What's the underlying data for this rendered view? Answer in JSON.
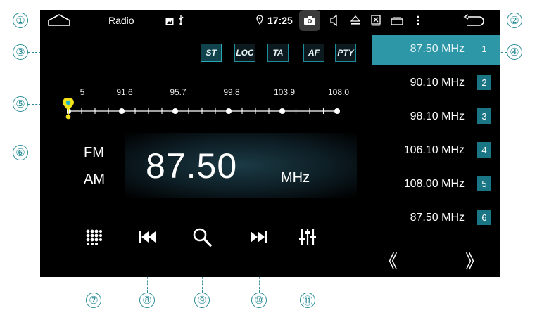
{
  "status_bar": {
    "app_title": "Radio",
    "time": "17:25"
  },
  "toggles": [
    {
      "label": "ST",
      "active": true
    },
    {
      "label": "LOC",
      "active": false
    },
    {
      "label": "TA",
      "active": false
    },
    {
      "label": "AF",
      "active": false
    },
    {
      "label": "PTY",
      "active": false
    }
  ],
  "tuning_scale": {
    "labels": [
      "5",
      "91.6",
      "95.7",
      "99.8",
      "103.9",
      "108.0"
    ],
    "marker_value": 87.5
  },
  "bands": {
    "fm": "FM",
    "am": "AM",
    "selected": "FM"
  },
  "display": {
    "frequency": "87.50",
    "unit": "MHz"
  },
  "presets": [
    {
      "frequency": "87.50 MHz",
      "number": "1",
      "active": true
    },
    {
      "frequency": "90.10 MHz",
      "number": "2",
      "active": false
    },
    {
      "frequency": "98.10 MHz",
      "number": "3",
      "active": false
    },
    {
      "frequency": "106.10 MHz",
      "number": "4",
      "active": false
    },
    {
      "frequency": "108.00 MHz",
      "number": "5",
      "active": false
    },
    {
      "frequency": "87.50 MHz",
      "number": "6",
      "active": false
    }
  ],
  "preset_nav": {
    "prev": "《",
    "next": "》"
  },
  "callouts": [
    "①",
    "②",
    "③",
    "④",
    "⑤",
    "⑥",
    "⑦",
    "⑧",
    "⑨",
    "⑩",
    "⑪"
  ],
  "colors": {
    "accent": "#2d97a8",
    "callout": "#2a8c96",
    "background": "#000000"
  }
}
